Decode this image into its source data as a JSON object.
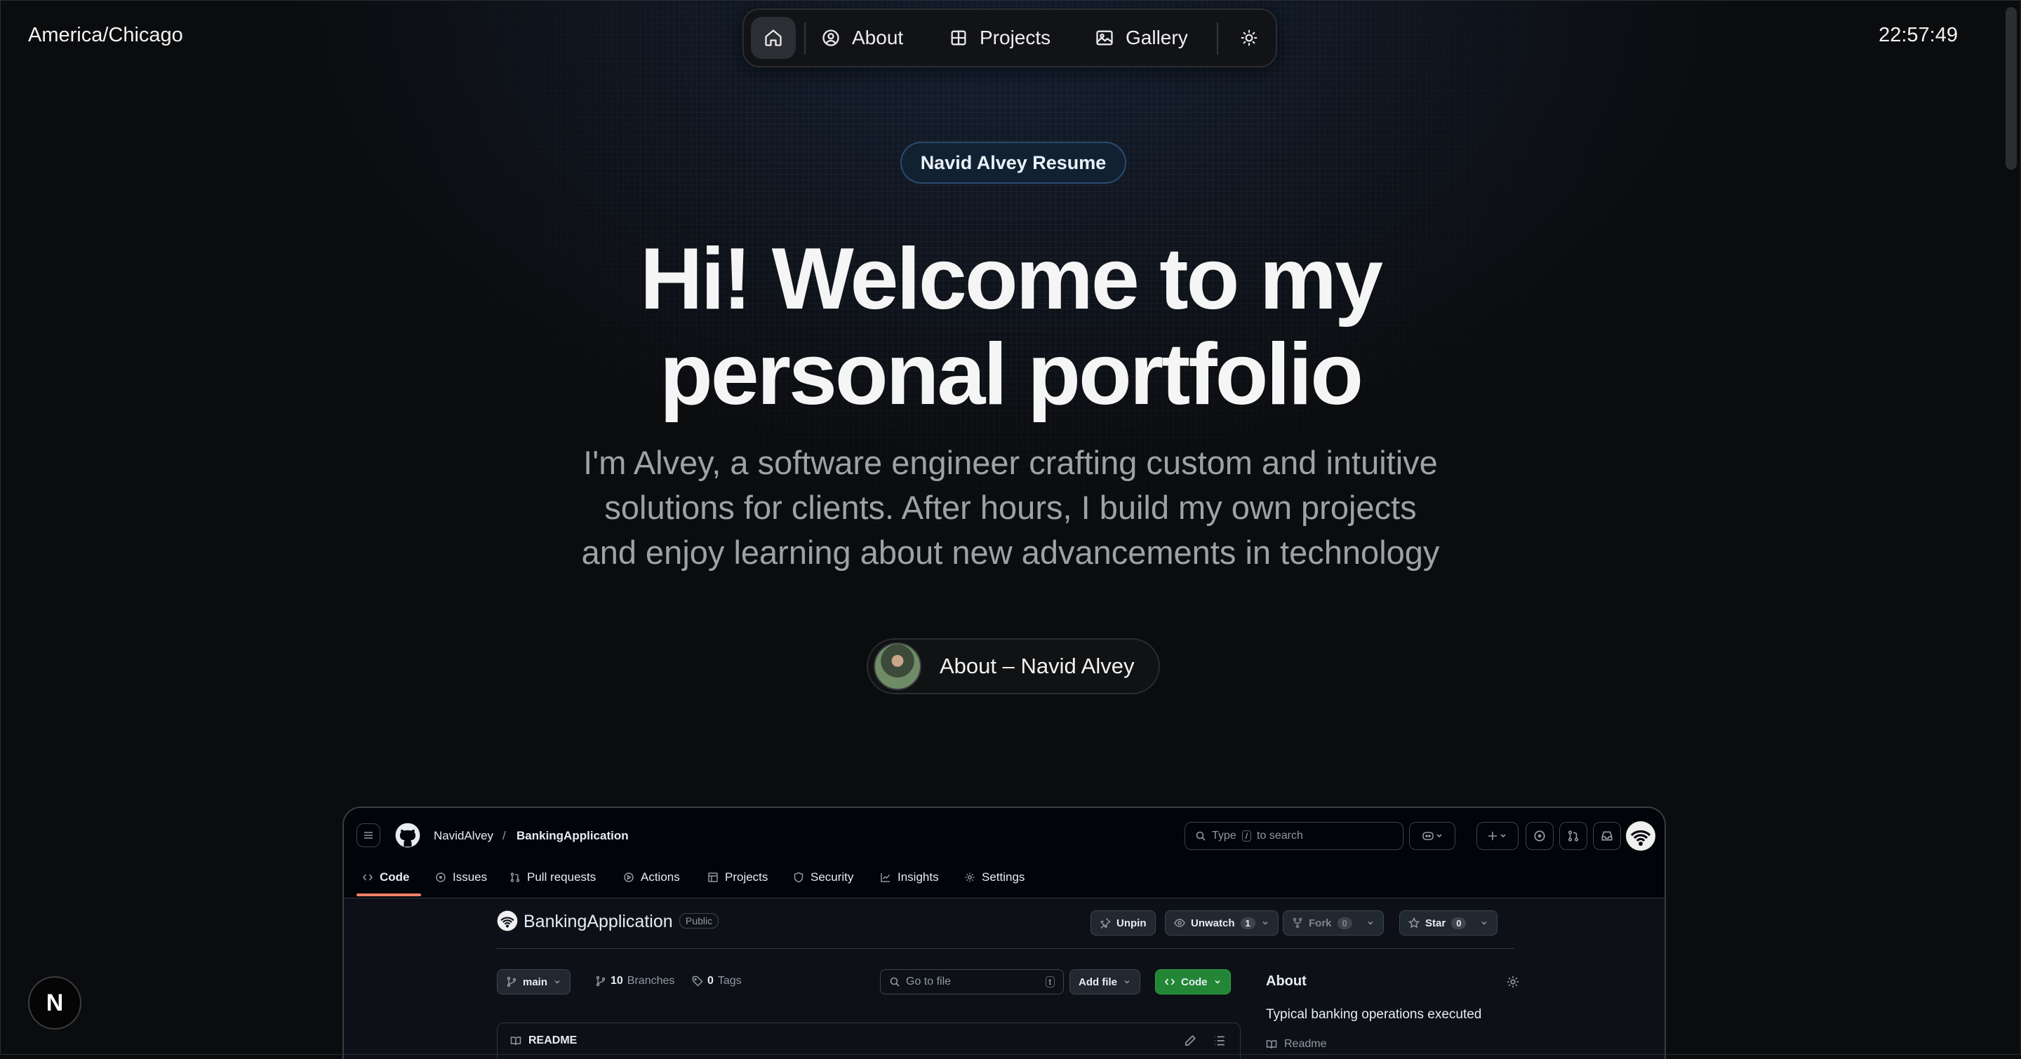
{
  "header": {
    "timezone": "America/Chicago",
    "clock": "22:57:49"
  },
  "nav": {
    "items": [
      {
        "label": "About",
        "icon": "user-circle-icon"
      },
      {
        "label": "Projects",
        "icon": "grid-icon"
      },
      {
        "label": "Gallery",
        "icon": "image-icon"
      }
    ],
    "home_icon": "home-icon",
    "theme_icon": "sun-icon"
  },
  "hero": {
    "badge": "Navid Alvey Resume",
    "title_line1": "Hi! Welcome to my",
    "title_line2": "personal portfolio",
    "subtitle_line1": "I'm Alvey, a software engineer crafting custom and intuitive",
    "subtitle_line2": "solutions for clients. After hours, I build my own projects",
    "subtitle_line3": "and enjoy learning about new advancements in technology",
    "about_button": "About – Navid Alvey"
  },
  "framework_badge": "N",
  "github": {
    "owner": "NavidAlvey",
    "separator": "/",
    "repo": "BankingApplication",
    "search_prefix": "Type",
    "search_key": "/",
    "search_suffix": "to search",
    "tabs": [
      "Code",
      "Issues",
      "Pull requests",
      "Actions",
      "Projects",
      "Security",
      "Insights",
      "Settings"
    ],
    "visibility": "Public",
    "unpin": "Unpin",
    "unwatch": "Unwatch",
    "watch_count": "1",
    "fork": "Fork",
    "fork_count": "0",
    "star": "Star",
    "star_count": "0",
    "branch": "main",
    "branches_count": "10",
    "branches_label": "Branches",
    "tags_count": "0",
    "tags_label": "Tags",
    "goto_placeholder": "Go to file",
    "goto_key": "t",
    "add_file": "Add file",
    "code_button": "Code",
    "readme_tab": "README",
    "about_heading": "About",
    "about_description": "Typical banking operations executed",
    "about_readme": "Readme"
  },
  "colors": {
    "page_bg": "#0b0c0e",
    "resume_badge_bg": "#122132",
    "resume_badge_border": "#2a4a6e",
    "github_bg": "#0d1117",
    "github_code_green": "#238636",
    "github_tab_underline": "#f78166"
  }
}
